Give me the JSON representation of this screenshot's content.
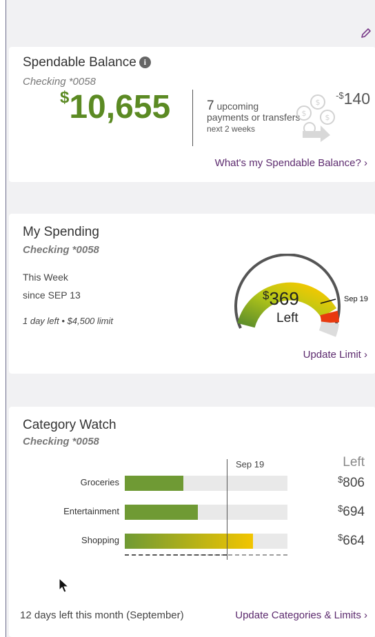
{
  "spendable": {
    "title": "Spendable Balance",
    "info_icon": "info-icon",
    "account": "Checking *0058",
    "currency": "$",
    "balance": "10,655",
    "upcoming_count": "7",
    "upcoming_text1": "upcoming",
    "upcoming_text2": "payments or transfers",
    "upcoming_period": "next 2 weeks",
    "upcoming_amount_prefix": "-$",
    "upcoming_amount": "140",
    "link": "What's my Spendable Balance?"
  },
  "spending": {
    "title": "My Spending",
    "account": "Checking *0058",
    "period": "This Week",
    "since": "since SEP 13",
    "limit_note": "1 day left • $4,500 limit",
    "gauge_currency": "$",
    "gauge_amount": "369",
    "gauge_label": "Left",
    "gauge_marker": "Sep 19",
    "gauge_fraction_spent": 0.918,
    "link": "Update Limit"
  },
  "category_watch": {
    "title": "Category Watch",
    "account": "Checking *0058",
    "today_label": "Sep 19",
    "left_header": "Left",
    "categories": [
      {
        "name": "Groceries",
        "currency": "$",
        "left": "806",
        "fraction_spent": 0.36
      },
      {
        "name": "Entertainment",
        "currency": "$",
        "left": "694",
        "fraction_spent": 0.45
      },
      {
        "name": "Shopping",
        "currency": "$",
        "left": "664",
        "fraction_spent": 0.79
      }
    ],
    "footer_note": "12 days left this month (September)",
    "link": "Update Categories & Limits"
  },
  "colors": {
    "accent_green": "#5b8a23",
    "link_purple": "#5c2a6e",
    "bar_green": "#6f9a34",
    "bar_yellow": "#f2c500"
  }
}
